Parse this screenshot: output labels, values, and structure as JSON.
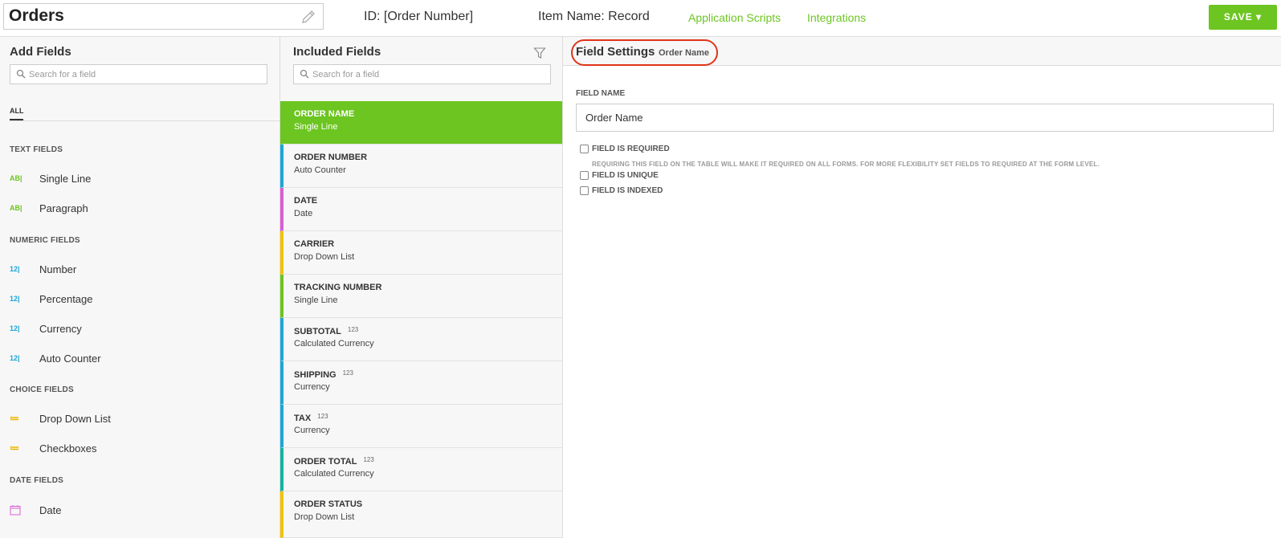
{
  "topbar": {
    "app_title": "Orders",
    "id_text": "ID: [Order Number]",
    "item_name_text": "Item Name: Record",
    "link_scripts": "Application Scripts",
    "link_integrations": "Integrations",
    "save_label": "SAVE ▾"
  },
  "add_fields": {
    "heading": "Add Fields",
    "search_placeholder": "Search for a field",
    "tab_all": "ALL",
    "sections": [
      {
        "title": "TEXT FIELDS",
        "items": [
          {
            "icon": "AB|",
            "label": "Single Line"
          },
          {
            "icon": "AB|",
            "label": "Paragraph"
          }
        ]
      },
      {
        "title": "NUMERIC FIELDS",
        "items": [
          {
            "icon": "12|",
            "label": "Number"
          },
          {
            "icon": "12|",
            "label": "Percentage"
          },
          {
            "icon": "12|",
            "label": "Currency"
          },
          {
            "icon": "12|",
            "label": "Auto Counter"
          }
        ]
      },
      {
        "title": "CHOICE FIELDS",
        "items": [
          {
            "icon": "≔",
            "label": "Drop Down List"
          },
          {
            "icon": "≔",
            "label": "Checkboxes"
          }
        ]
      },
      {
        "title": "DATE FIELDS",
        "items": [
          {
            "icon": "calendar-icon",
            "label": "Date"
          }
        ]
      }
    ]
  },
  "included_fields": {
    "heading": "Included Fields",
    "search_placeholder": "Search for a field",
    "items": [
      {
        "name": "ORDER NAME",
        "type": "Single Line",
        "tag": "",
        "color": "#6cc520"
      },
      {
        "name": "ORDER NUMBER",
        "type": "Auto Counter",
        "tag": "",
        "color": "#1ea6d6"
      },
      {
        "name": "DATE",
        "type": "Date",
        "tag": "",
        "color": "#d95fd3"
      },
      {
        "name": "CARRIER",
        "type": "Drop Down List",
        "tag": "",
        "color": "#f0c400"
      },
      {
        "name": "TRACKING NUMBER",
        "type": "Single Line",
        "tag": "",
        "color": "#6cc520"
      },
      {
        "name": "SUBTOTAL",
        "type": "Calculated Currency",
        "tag": "123",
        "color": "#1ea6d6"
      },
      {
        "name": "SHIPPING",
        "type": "Currency",
        "tag": "123",
        "color": "#1ea6d6"
      },
      {
        "name": "TAX",
        "type": "Currency",
        "tag": "123",
        "color": "#1ea6d6"
      },
      {
        "name": "ORDER TOTAL",
        "type": "Calculated Currency",
        "tag": "123",
        "color": "#16b3a0"
      },
      {
        "name": "ORDER STATUS",
        "type": "Drop Down List",
        "tag": "",
        "color": "#f0c400"
      }
    ]
  },
  "field_settings": {
    "title": "Field Settings",
    "subtitle": "Order Name",
    "field_name_label": "FIELD NAME",
    "field_name_value": "Order Name",
    "required_label": "FIELD IS REQUIRED",
    "required_hint": "REQUIRING THIS FIELD ON THE TABLE WILL MAKE IT REQUIRED ON ALL FORMS. FOR MORE FLEXIBILITY SET FIELDS TO REQUIRED AT THE FORM LEVEL.",
    "unique_label": "FIELD IS UNIQUE",
    "indexed_label": "FIELD IS INDEXED"
  }
}
